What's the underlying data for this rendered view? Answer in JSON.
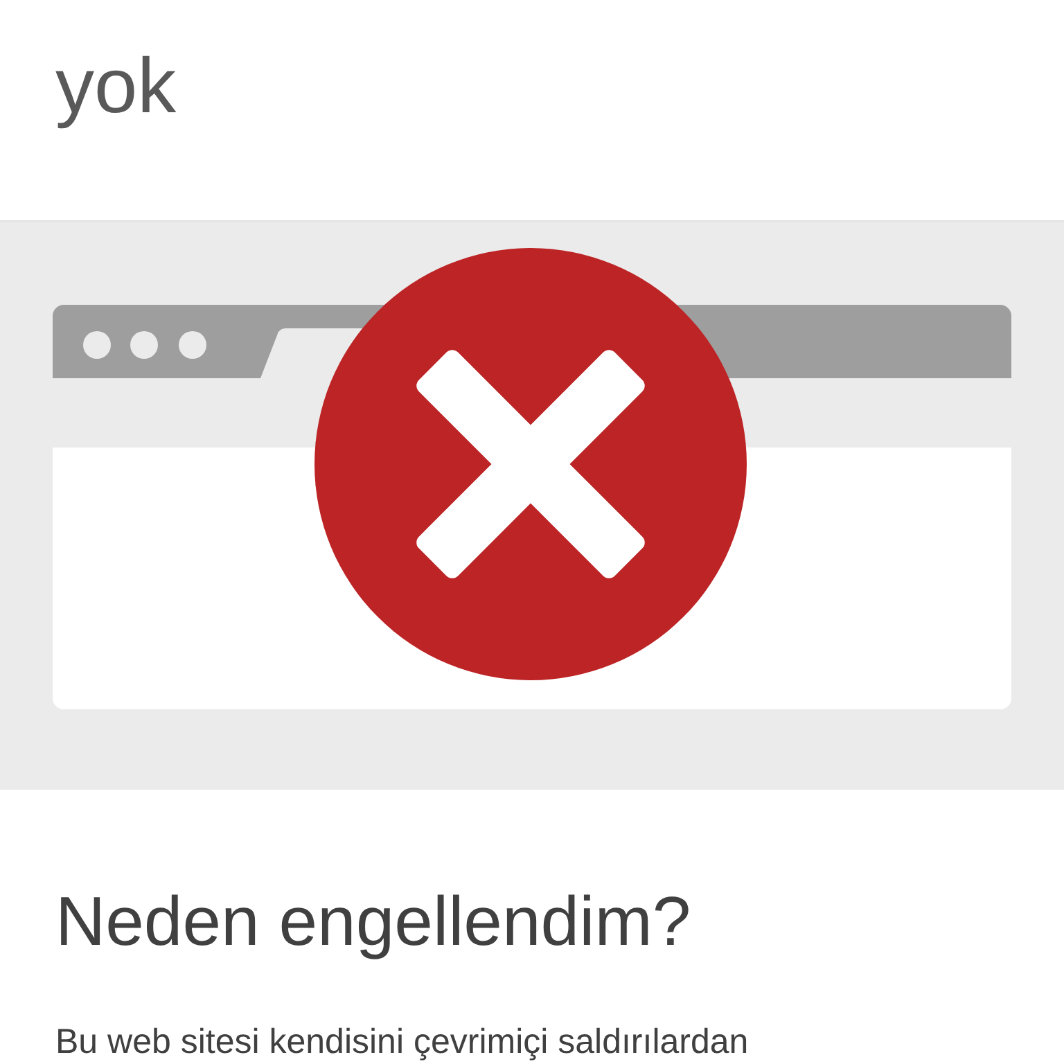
{
  "title": "yok",
  "heading": "Neden engellendim?",
  "body": "Bu web sitesi kendisini çevrimiçi saldırılardan"
}
